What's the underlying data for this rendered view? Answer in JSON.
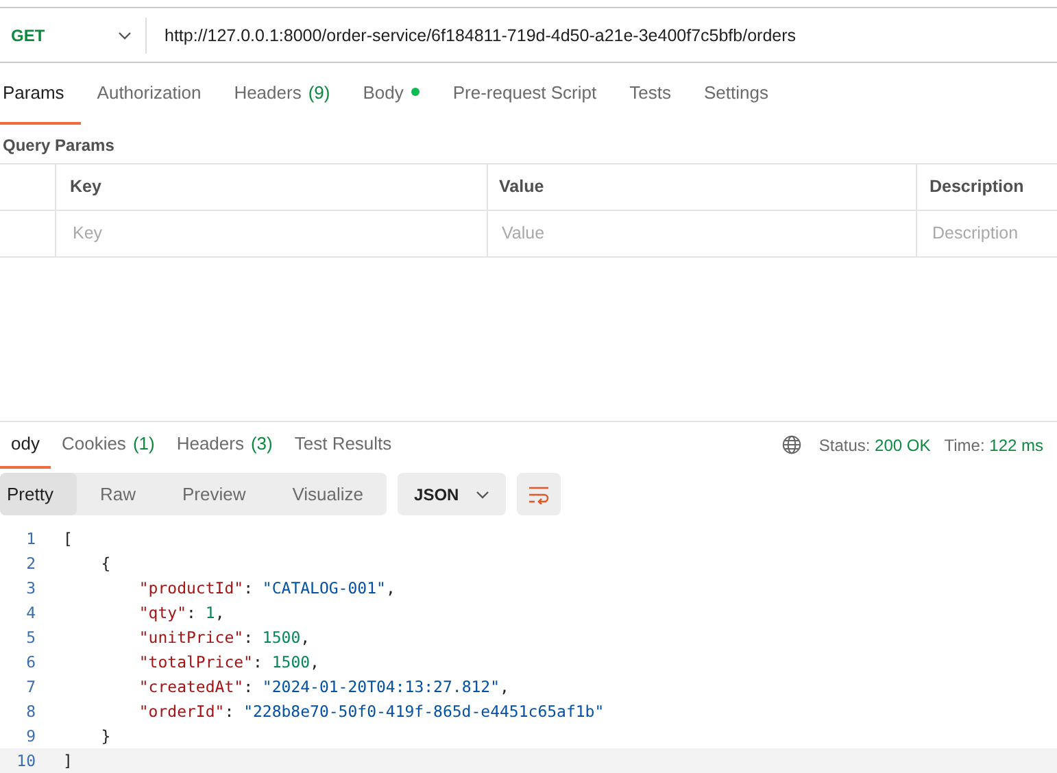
{
  "request": {
    "method": "GET",
    "url": "http://127.0.0.1:8000/order-service/6f184811-719d-4d50-a21e-3e400f7c5bfb/orders"
  },
  "request_tabs": [
    {
      "label": "Params",
      "dot": false,
      "selected": true
    },
    {
      "label": "Authorization",
      "dot": false,
      "selected": false
    },
    {
      "label": "Headers",
      "count": "(9)",
      "dot": false,
      "selected": false
    },
    {
      "label": "Body",
      "dot": true,
      "selected": false
    },
    {
      "label": "Pre-request Script",
      "dot": false,
      "selected": false
    },
    {
      "label": "Tests",
      "dot": false,
      "selected": false
    },
    {
      "label": "Settings",
      "dot": false,
      "selected": false
    }
  ],
  "query_params": {
    "title": "Query Params",
    "columns": [
      "Key",
      "Value",
      "Description"
    ],
    "placeholders": [
      "Key",
      "Value",
      "Description"
    ]
  },
  "response_tabs": [
    {
      "label": "ody",
      "selected": true
    },
    {
      "label": "Cookies",
      "count": "(1)",
      "selected": false
    },
    {
      "label": "Headers",
      "count": "(3)",
      "selected": false
    },
    {
      "label": "Test Results",
      "selected": false
    }
  ],
  "status": {
    "status_label": "Status:",
    "status_value": "200 OK",
    "time_label": "Time:",
    "time_value": "122 ms"
  },
  "view_modes": [
    {
      "label": "Pretty",
      "selected": true
    },
    {
      "label": "Raw",
      "selected": false
    },
    {
      "label": "Preview",
      "selected": false
    },
    {
      "label": "Visualize",
      "selected": false
    }
  ],
  "format": "JSON",
  "code_lines": [
    {
      "number": "1",
      "tokens": [
        {
          "kind": "punct",
          "text": "["
        }
      ]
    },
    {
      "number": "2",
      "tokens": [
        {
          "kind": "punct",
          "text": "    {"
        }
      ]
    },
    {
      "number": "3",
      "tokens": [
        {
          "kind": "key",
          "text": "        \"productId\""
        },
        {
          "kind": "punct",
          "text": ": "
        },
        {
          "kind": "string",
          "text": "\"CATALOG-001\""
        },
        {
          "kind": "punct",
          "text": ","
        }
      ]
    },
    {
      "number": "4",
      "tokens": [
        {
          "kind": "key",
          "text": "        \"qty\""
        },
        {
          "kind": "punct",
          "text": ": "
        },
        {
          "kind": "number",
          "text": "1"
        },
        {
          "kind": "punct",
          "text": ","
        }
      ]
    },
    {
      "number": "5",
      "tokens": [
        {
          "kind": "key",
          "text": "        \"unitPrice\""
        },
        {
          "kind": "punct",
          "text": ": "
        },
        {
          "kind": "number",
          "text": "1500"
        },
        {
          "kind": "punct",
          "text": ","
        }
      ]
    },
    {
      "number": "6",
      "tokens": [
        {
          "kind": "key",
          "text": "        \"totalPrice\""
        },
        {
          "kind": "punct",
          "text": ": "
        },
        {
          "kind": "number",
          "text": "1500"
        },
        {
          "kind": "punct",
          "text": ","
        }
      ]
    },
    {
      "number": "7",
      "tokens": [
        {
          "kind": "key",
          "text": "        \"createdAt\""
        },
        {
          "kind": "punct",
          "text": ": "
        },
        {
          "kind": "string",
          "text": "\"2024-01-20T04:13:27.812\""
        },
        {
          "kind": "punct",
          "text": ","
        }
      ]
    },
    {
      "number": "8",
      "tokens": [
        {
          "kind": "key",
          "text": "        \"orderId\""
        },
        {
          "kind": "punct",
          "text": ": "
        },
        {
          "kind": "string",
          "text": "\"228b8e70-50f0-419f-865d-e4451c65af1b\""
        }
      ]
    },
    {
      "number": "9",
      "tokens": [
        {
          "kind": "punct",
          "text": "    }"
        }
      ]
    },
    {
      "number": "10",
      "tokens": [
        {
          "kind": "punct",
          "text": "]"
        }
      ]
    }
  ]
}
